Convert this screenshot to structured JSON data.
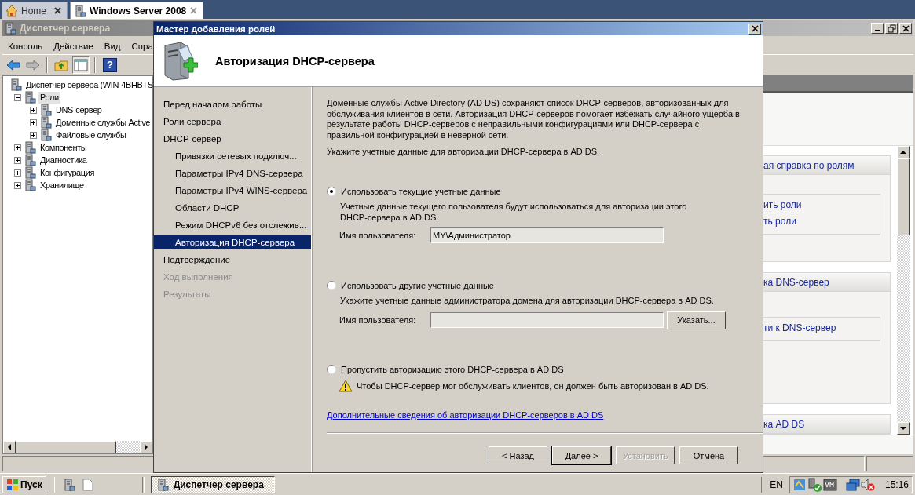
{
  "browser_tabs": [
    {
      "label": "Home",
      "selected": false
    },
    {
      "label": "Windows Server 2008",
      "selected": true
    }
  ],
  "server_manager": {
    "title": "Диспетчер сервера",
    "menu": [
      "Консоль",
      "Действие",
      "Вид",
      "Спра"
    ],
    "help_glyph": "?",
    "tree": [
      {
        "label": "Диспетчер сервера (WIN-4BHBTS",
        "selected": false,
        "children": [
          {
            "label": "Роли",
            "selected": true,
            "expanded": true,
            "children": [
              {
                "label": "DNS-сервер",
                "selected": false,
                "expanded": false
              },
              {
                "label": "Доменные службы Active",
                "selected": false,
                "expanded": false
              },
              {
                "label": "Файловые службы",
                "selected": false,
                "expanded": false
              }
            ]
          },
          {
            "label": "Компоненты",
            "selected": false,
            "expanded": false
          },
          {
            "label": "Диагностика",
            "selected": false,
            "expanded": false
          },
          {
            "label": "Конфигурация",
            "selected": false,
            "expanded": false
          },
          {
            "label": "Хранилище",
            "selected": false,
            "expanded": false
          }
        ]
      }
    ],
    "right_pane": {
      "sections": [
        {
          "header": "ая справка по ролям",
          "links": [
            "ить роли",
            "ть роли"
          ]
        },
        {
          "header": "ка DNS-сервер",
          "links": [
            "ти к DNS-сервер"
          ]
        },
        {
          "header": "ка AD DS"
        }
      ]
    }
  },
  "wizard": {
    "title": "Мастер добавления ролей",
    "heading": "Авторизация DHCP-сервера",
    "nav": [
      {
        "label": "Перед началом работы",
        "selected": false,
        "disabled": false
      },
      {
        "label": "Роли сервера",
        "selected": false,
        "disabled": false
      },
      {
        "label": "DHCP-сервер",
        "selected": false,
        "disabled": false,
        "children": [
          {
            "label": "Привязки сетевых подключ...",
            "selected": false,
            "disabled": false
          },
          {
            "label": "Параметры IPv4 DNS-сервера",
            "selected": false,
            "disabled": false
          },
          {
            "label": "Параметры IPv4 WINS-сервера",
            "selected": false,
            "disabled": false
          },
          {
            "label": "Области DHCP",
            "selected": false,
            "disabled": false
          },
          {
            "label": "Режим DHCPv6 без отслежив...",
            "selected": false,
            "disabled": false
          },
          {
            "label": "Авторизация DHCP-сервера",
            "selected": true,
            "disabled": false
          }
        ]
      },
      {
        "label": "Подтверждение",
        "selected": false,
        "disabled": false
      },
      {
        "label": "Ход выполнения",
        "selected": false,
        "disabled": true
      },
      {
        "label": "Результаты",
        "selected": false,
        "disabled": true
      }
    ],
    "intro": "Доменные службы Active Directory (AD DS) сохраняют список DHCP-серверов, авторизованных для обслуживания клиентов в сети. Авторизация DHCP-серверов помогает избежать случайного ущерба в результате работы DHCP-серверов с неправильными конфигурациями или DHCP-сервера с правильной конфигурацией в неверной сети.",
    "prompt": "Укажите учетные данные для авторизации DHCP-сервера в AD DS.",
    "options": [
      {
        "label": "Использовать текущие учетные данные",
        "selected": true,
        "description": "Учетные данные текущего пользователя будут использоваться для авторизации этого DHCP-сервера в AD DS.",
        "field_label": "Имя пользователя:",
        "field_value": "MY\\Администратор"
      },
      {
        "label": "Использовать другие учетные данные",
        "selected": false,
        "description": "Укажите учетные данные администратора домена для авторизации DHCP-сервера в AD DS.",
        "field_label": "Имя пользователя:",
        "button": "Указать..."
      },
      {
        "label": "Пропустить авторизацию этого DHCP-сервера в AD DS",
        "selected": false,
        "warning": "Чтобы DHCP-сервер мог обслуживать клиентов, он должен быть авторизован в AD DS."
      }
    ],
    "link": "Дополнительные сведения об авторизации DHCP-серверов в AD DS",
    "buttons": [
      {
        "label": "< Назад",
        "default": false,
        "disabled": false
      },
      {
        "label": "Далее >",
        "default": true,
        "disabled": false
      },
      {
        "label": "Установить",
        "default": false,
        "disabled": true
      },
      {
        "label": "Отмена",
        "default": false,
        "disabled": false
      }
    ]
  },
  "taskbar": {
    "start": "Пуск",
    "tasks": [
      {
        "label": "Диспетчер сервера",
        "selected": true
      }
    ],
    "language": "EN",
    "clock": "15:16"
  }
}
